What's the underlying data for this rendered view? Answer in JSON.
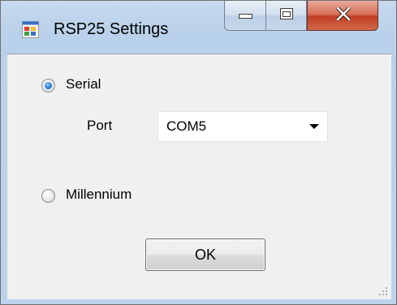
{
  "window": {
    "title": "RSP25 Settings"
  },
  "icons": {
    "app": "application-icon",
    "minimize": "minimize-icon",
    "maximize": "maximize-icon",
    "close": "close-icon",
    "dropdown": "chevron-down-icon",
    "grip": "resize-grip-icon"
  },
  "form": {
    "serial_label": "Serial",
    "serial_selected": true,
    "port_label": "Port",
    "port_value": "COM5",
    "millennium_label": "Millennium",
    "millennium_selected": false,
    "ok_label": "OK"
  },
  "colors": {
    "close_button": "#c13f25",
    "radio_selected": "#2b7bd6",
    "client_background": "#f0f0f0"
  }
}
